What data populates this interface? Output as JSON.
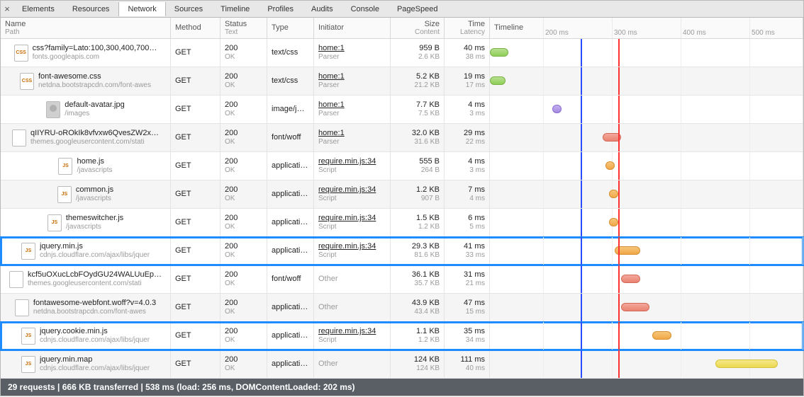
{
  "tabs": [
    "Elements",
    "Resources",
    "Network",
    "Sources",
    "Timeline",
    "Profiles",
    "Audits",
    "Console",
    "PageSpeed"
  ],
  "active_tab": "Network",
  "headers": {
    "name": {
      "lbl": "Name",
      "sub": "Path"
    },
    "method": {
      "lbl": "Method",
      "sub": ""
    },
    "status": {
      "lbl": "Status",
      "sub": "Text"
    },
    "type": {
      "lbl": "Type",
      "sub": ""
    },
    "initiator": {
      "lbl": "Initiator",
      "sub": ""
    },
    "size": {
      "lbl": "Size",
      "sub": "Content"
    },
    "time": {
      "lbl": "Time",
      "sub": "Latency"
    },
    "timeline": {
      "lbl": "Timeline",
      "sub": ""
    }
  },
  "ticks": [
    {
      "label": "200 ms",
      "pct": 17
    },
    {
      "label": "300 ms",
      "pct": 39
    },
    {
      "label": "400 ms",
      "pct": 61
    },
    {
      "label": "500 ms",
      "pct": 83
    }
  ],
  "markers": {
    "blue_pct": 29,
    "red_pct": 41
  },
  "rows": [
    {
      "icon": "css",
      "name": "css?family=Lato:100,300,400,700…",
      "path": "fonts.googleapis.com",
      "method": "GET",
      "status": "200",
      "status_txt": "OK",
      "type": "text/css",
      "initiator": "home:1",
      "initiator_sub": "Parser",
      "initiator_link": true,
      "size": "959 B",
      "content": "2.6 KB",
      "time": "40 ms",
      "latency": "38 ms",
      "bar": {
        "color": "green",
        "start": 0,
        "width": 6
      },
      "hl": false
    },
    {
      "icon": "css",
      "name": "font-awesome.css",
      "path": "netdna.bootstrapcdn.com/font-awes",
      "method": "GET",
      "status": "200",
      "status_txt": "OK",
      "type": "text/css",
      "initiator": "home:1",
      "initiator_sub": "Parser",
      "initiator_link": true,
      "size": "5.2 KB",
      "content": "21.2 KB",
      "time": "19 ms",
      "latency": "17 ms",
      "bar": {
        "color": "green",
        "start": 0,
        "width": 5
      },
      "hl": false
    },
    {
      "icon": "img",
      "name": "default-avatar.jpg",
      "path": "/images",
      "method": "GET",
      "status": "200",
      "status_txt": "OK",
      "type": "image/j…",
      "initiator": "home:1",
      "initiator_sub": "Parser",
      "initiator_link": true,
      "size": "7.7 KB",
      "content": "7.5 KB",
      "time": "4 ms",
      "latency": "3 ms",
      "bar": {
        "color": "purple",
        "start": 20,
        "width": 3
      },
      "hl": false
    },
    {
      "icon": "font",
      "name": "qIIYRU-oROkIk8vfvxw6QvesZW2x…",
      "path": "themes.googleusercontent.com/stati",
      "method": "GET",
      "status": "200",
      "status_txt": "OK",
      "type": "font/woff",
      "initiator": "home:1",
      "initiator_sub": "Parser",
      "initiator_link": true,
      "size": "32.0 KB",
      "content": "31.6 KB",
      "time": "29 ms",
      "latency": "22 ms",
      "bar": {
        "color": "red",
        "start": 36,
        "width": 6
      },
      "hl": false
    },
    {
      "icon": "js",
      "name": "home.js",
      "path": "/javascripts",
      "method": "GET",
      "status": "200",
      "status_txt": "OK",
      "type": "applicati…",
      "initiator": "require.min.js:34",
      "initiator_sub": "Script",
      "initiator_link": true,
      "size": "555 B",
      "content": "264 B",
      "time": "4 ms",
      "latency": "3 ms",
      "bar": {
        "color": "orange",
        "start": 37,
        "width": 3
      },
      "hl": false
    },
    {
      "icon": "js",
      "name": "common.js",
      "path": "/javascripts",
      "method": "GET",
      "status": "200",
      "status_txt": "OK",
      "type": "applicati…",
      "initiator": "require.min.js:34",
      "initiator_sub": "Script",
      "initiator_link": true,
      "size": "1.2 KB",
      "content": "907 B",
      "time": "7 ms",
      "latency": "4 ms",
      "bar": {
        "color": "orange",
        "start": 38,
        "width": 3
      },
      "hl": false
    },
    {
      "icon": "js",
      "name": "themeswitcher.js",
      "path": "/javascripts",
      "method": "GET",
      "status": "200",
      "status_txt": "OK",
      "type": "applicati…",
      "initiator": "require.min.js:34",
      "initiator_sub": "Script",
      "initiator_link": true,
      "size": "1.5 KB",
      "content": "1.2 KB",
      "time": "6 ms",
      "latency": "5 ms",
      "bar": {
        "color": "orange",
        "start": 38,
        "width": 3
      },
      "hl": false
    },
    {
      "icon": "js",
      "name": "jquery.min.js",
      "path": "cdnjs.cloudflare.com/ajax/libs/jquer",
      "method": "GET",
      "status": "200",
      "status_txt": "OK",
      "type": "applicati…",
      "initiator": "require.min.js:34",
      "initiator_sub": "Script",
      "initiator_link": true,
      "size": "29.3 KB",
      "content": "81.6 KB",
      "time": "41 ms",
      "latency": "33 ms",
      "bar": {
        "color": "orange",
        "start": 40,
        "width": 8
      },
      "hl": true
    },
    {
      "icon": "font",
      "name": "kcf5uOXucLcbFOydGU24WALUuEp…",
      "path": "themes.googleusercontent.com/stati",
      "method": "GET",
      "status": "200",
      "status_txt": "OK",
      "type": "font/woff",
      "initiator": "Other",
      "initiator_sub": "",
      "initiator_link": false,
      "size": "36.1 KB",
      "content": "35.7 KB",
      "time": "31 ms",
      "latency": "21 ms",
      "bar": {
        "color": "red",
        "start": 42,
        "width": 6
      },
      "hl": false
    },
    {
      "icon": "font",
      "name": "fontawesome-webfont.woff?v=4.0.3",
      "path": "netdna.bootstrapcdn.com/font-awes",
      "method": "GET",
      "status": "200",
      "status_txt": "OK",
      "type": "applicati…",
      "initiator": "Other",
      "initiator_sub": "",
      "initiator_link": false,
      "size": "43.9 KB",
      "content": "43.4 KB",
      "time": "47 ms",
      "latency": "15 ms",
      "bar": {
        "color": "red",
        "start": 42,
        "width": 9
      },
      "hl": false
    },
    {
      "icon": "js",
      "name": "jquery.cookie.min.js",
      "path": "cdnjs.cloudflare.com/ajax/libs/jquer",
      "method": "GET",
      "status": "200",
      "status_txt": "OK",
      "type": "applicati…",
      "initiator": "require.min.js:34",
      "initiator_sub": "Script",
      "initiator_link": true,
      "size": "1.1 KB",
      "content": "1.2 KB",
      "time": "35 ms",
      "latency": "34 ms",
      "bar": {
        "color": "orange",
        "start": 52,
        "width": 6
      },
      "hl": true
    },
    {
      "icon": "js",
      "name": "jquery.min.map",
      "path": "cdnjs.cloudflare.com/ajax/libs/jquer",
      "method": "GET",
      "status": "200",
      "status_txt": "OK",
      "type": "applicati…",
      "initiator": "Other",
      "initiator_sub": "",
      "initiator_link": false,
      "size": "124 KB",
      "content": "124 KB",
      "time": "111 ms",
      "latency": "40 ms",
      "bar": {
        "color": "yellow",
        "start": 72,
        "width": 20
      },
      "hl": false
    }
  ],
  "statusbar": "29 requests  |  666 KB transferred  |  538 ms (load: 256 ms, DOMContentLoaded: 202 ms)"
}
